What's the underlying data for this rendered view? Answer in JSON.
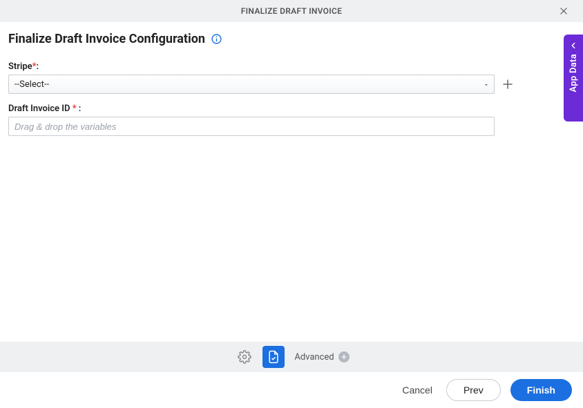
{
  "header": {
    "title": "FINALIZE DRAFT INVOICE"
  },
  "page": {
    "title": "Finalize Draft Invoice Configuration"
  },
  "fields": {
    "stripe": {
      "label": "Stripe",
      "required_marker": "*",
      "colon": ":",
      "selected": "--Select--"
    },
    "draft_invoice": {
      "label": "Draft Invoice ID ",
      "required_marker": "*",
      "trail": " :",
      "placeholder": "Drag & drop the variables",
      "value": ""
    }
  },
  "toolbar": {
    "advanced_label": "Advanced"
  },
  "footer": {
    "cancel": "Cancel",
    "prev": "Prev",
    "finish": "Finish"
  },
  "side": {
    "label": "App Data"
  }
}
